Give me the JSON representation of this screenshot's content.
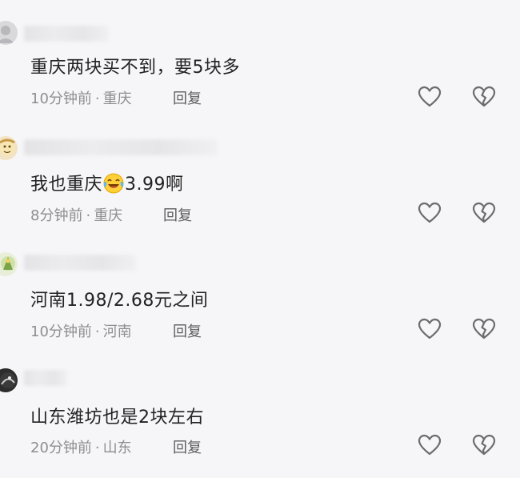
{
  "comments": [
    {
      "text": "重庆两块买不到，要5块多",
      "time": "10分钟前",
      "location": "重庆",
      "reply": "回复"
    },
    {
      "text_before": "我也重庆",
      "emoji": "laughing-crying-emoji",
      "text_after": "3.99啊",
      "time": "8分钟前",
      "location": "重庆",
      "reply": "回复"
    },
    {
      "text": "河南1.98/2.68元之间",
      "time": "10分钟前",
      "location": "河南",
      "reply": "回复"
    },
    {
      "text": "山东潍坊也是2块左右",
      "time": "20分钟前",
      "location": "山东",
      "reply": "回复"
    }
  ],
  "separator": "·",
  "colors": {
    "background": "#f6f6f8",
    "text": "#222222",
    "meta": "#8e8e93",
    "icon": "#6b6b70"
  }
}
